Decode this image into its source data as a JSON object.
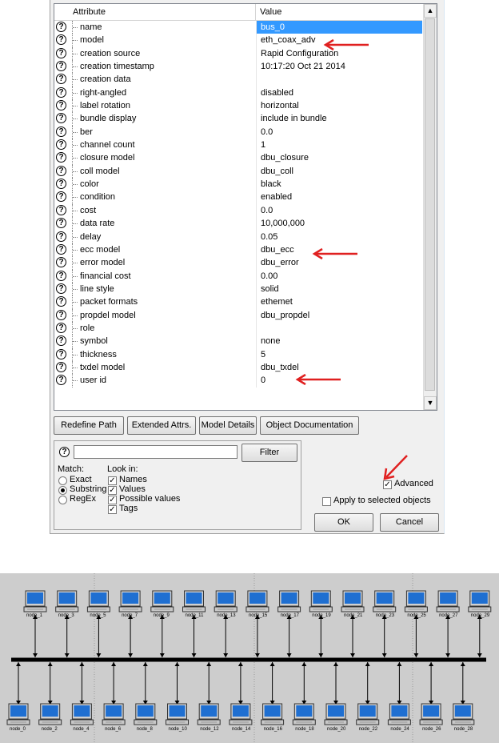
{
  "attributes_table": {
    "header": {
      "attribute": "Attribute",
      "value": "Value"
    },
    "rows": [
      {
        "name": "name",
        "value": "bus_0",
        "selected": true
      },
      {
        "name": "model",
        "value": "eth_coax_adv"
      },
      {
        "name": "creation source",
        "value": "Rapid Configuration"
      },
      {
        "name": "creation timestamp",
        "value": "10:17:20 Oct 21 2014"
      },
      {
        "name": "creation data",
        "value": ""
      },
      {
        "name": "right-angled",
        "value": "disabled"
      },
      {
        "name": "label rotation",
        "value": "horizontal"
      },
      {
        "name": "bundle display",
        "value": "include in bundle"
      },
      {
        "name": "ber",
        "value": "0.0"
      },
      {
        "name": "channel count",
        "value": "1"
      },
      {
        "name": "closure model",
        "value": "dbu_closure"
      },
      {
        "name": "coll model",
        "value": "dbu_coll"
      },
      {
        "name": "color",
        "value": "black"
      },
      {
        "name": "condition",
        "value": "enabled"
      },
      {
        "name": "cost",
        "value": "0.0"
      },
      {
        "name": "data rate",
        "value": "10,000,000"
      },
      {
        "name": "delay",
        "value": "0.05"
      },
      {
        "name": "ecc model",
        "value": "dbu_ecc"
      },
      {
        "name": "error model",
        "value": "dbu_error"
      },
      {
        "name": "financial cost",
        "value": "0.00"
      },
      {
        "name": "line style",
        "value": "solid"
      },
      {
        "name": "packet formats",
        "value": "ethemet"
      },
      {
        "name": "propdel model",
        "value": "dbu_propdel"
      },
      {
        "name": "role",
        "value": ""
      },
      {
        "name": "symbol",
        "value": "none"
      },
      {
        "name": "thickness",
        "value": "5"
      },
      {
        "name": "txdel model",
        "value": "dbu_txdel"
      },
      {
        "name": "user id",
        "value": "0"
      }
    ]
  },
  "buttons": {
    "redefine_path": "Redefine Path",
    "extended_attrs": "Extended Attrs.",
    "model_details": "Model Details",
    "object_documentation": "Object Documentation",
    "filter": "Filter",
    "ok": "OK",
    "cancel": "Cancel"
  },
  "filter": {
    "input_value": "",
    "match_label": "Match:",
    "match_options": [
      "Exact",
      "Substring",
      "RegEx"
    ],
    "match_selected": "Substring",
    "look_in_label": "Look in:",
    "look_in_options": [
      "Names",
      "Values",
      "Possible values",
      "Tags"
    ],
    "look_in_checked": [
      true,
      true,
      true,
      true
    ]
  },
  "options": {
    "advanced_label": "Advanced",
    "advanced_checked": true,
    "apply_selected_label": "Apply to selected objects",
    "apply_selected_checked": false
  },
  "icons": {
    "help": "?",
    "scroll_up": "▲",
    "scroll_down": "▼",
    "check": "✓"
  },
  "colors": {
    "selection": "#3399ff",
    "annotation_arrow": "#e02020",
    "network_bg": "#cdcdcd",
    "monitor": "#1f6fd1"
  },
  "network": {
    "top_nodes": [
      "node_1",
      "node_3",
      "node_5",
      "node_7",
      "node_9",
      "node_11",
      "node_13",
      "node_15",
      "node_17",
      "node_19",
      "node_21",
      "node_23",
      "node_25",
      "node_27",
      "node_29"
    ],
    "bottom_nodes": [
      "node_0",
      "node_2",
      "node_4",
      "node_6",
      "node_8",
      "node_10",
      "node_12",
      "node_14",
      "node_16",
      "node_18",
      "node_20",
      "node_22",
      "node_24",
      "node_26",
      "node_28"
    ]
  }
}
